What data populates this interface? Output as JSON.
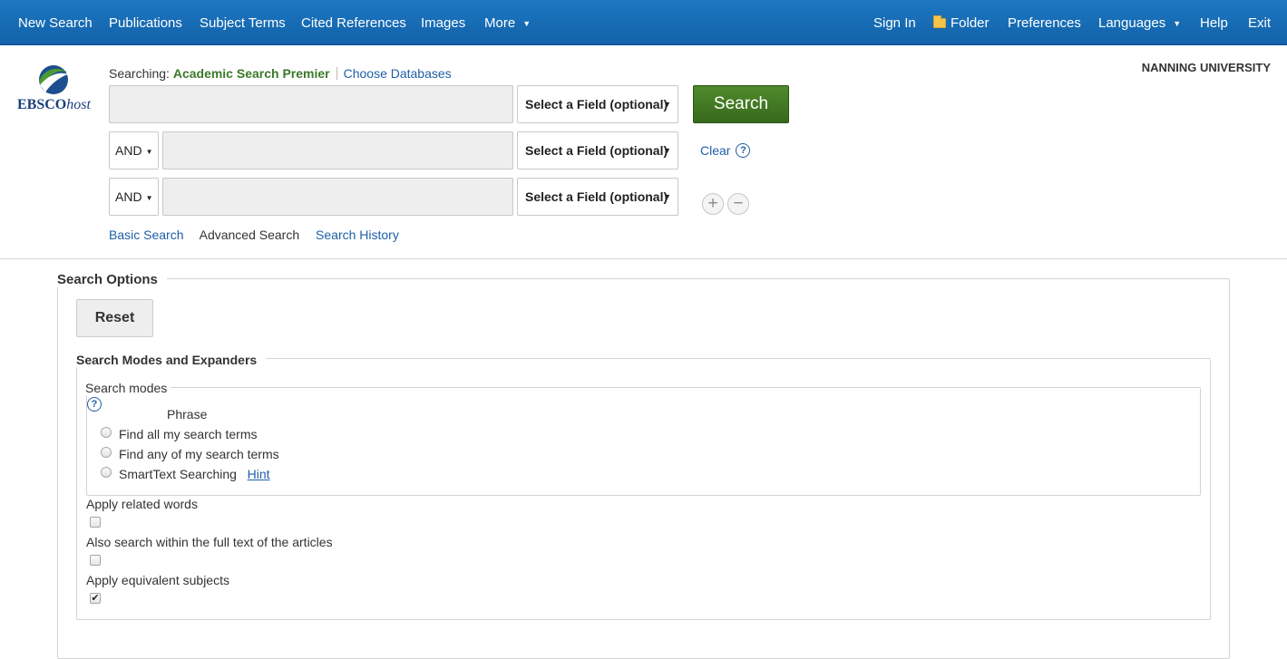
{
  "nav": {
    "left": [
      {
        "label": "New Search"
      },
      {
        "label": "Publications"
      },
      {
        "label": "Subject Terms"
      },
      {
        "label": "Cited References"
      },
      {
        "label": "Images"
      },
      {
        "label": "More"
      }
    ],
    "right": {
      "sign_in": "Sign In",
      "folder": "Folder",
      "preferences": "Preferences",
      "languages": "Languages",
      "help": "Help",
      "exit": "Exit"
    }
  },
  "header": {
    "logo_text": "EBSCO",
    "logo_host": "host",
    "institution": "NANNING UNIVERSITY",
    "searching_label": "Searching:",
    "database": "Academic Search Premier",
    "choose_databases": "Choose Databases"
  },
  "search": {
    "rows": [
      {
        "operator": "",
        "value": "",
        "field": "Select a Field (optional)"
      },
      {
        "operator": "AND",
        "value": "",
        "field": "Select a Field (optional)"
      },
      {
        "operator": "AND",
        "value": "",
        "field": "Select a Field (optional)"
      }
    ],
    "search_button": "Search",
    "clear_link": "Clear",
    "help_glyph": "?",
    "add_glyph": "+",
    "remove_glyph": "−",
    "links": {
      "basic": "Basic Search",
      "advanced": "Advanced Search",
      "history": "Search History"
    }
  },
  "options": {
    "legend": "Search Options",
    "reset": "Reset",
    "modes_legend": "Search Modes and Expanders",
    "search_modes_label": "Search modes",
    "help_glyph": "?",
    "radio_items": [
      {
        "label": "Phrase",
        "selected": false
      },
      {
        "label": "Find all my search terms",
        "selected": false
      },
      {
        "label": "Find any of my search terms",
        "selected": false
      },
      {
        "label": "SmartText Searching",
        "selected": false
      }
    ],
    "hint_link": "Hint",
    "expanders": [
      {
        "label": "Apply related words",
        "checked": false
      },
      {
        "label": "Also search within the full text of the articles",
        "checked": false
      },
      {
        "label": "Apply equivalent subjects",
        "checked": true
      }
    ],
    "check_glyph": "✔"
  },
  "colors": {
    "nav_bg": "#1a6eb8",
    "search_button": "#3f7a22",
    "link": "#1f5fa8",
    "database_name": "#3a7a2a"
  }
}
